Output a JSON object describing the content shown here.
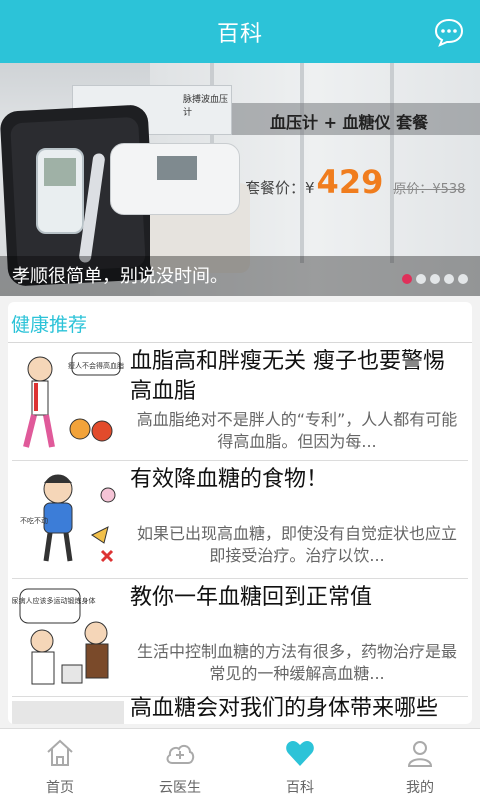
{
  "header": {
    "title": "百科"
  },
  "banner": {
    "tag": "血压计 + 血糖仪  套餐",
    "price_label": "套餐价：¥",
    "price_value": "429",
    "orig_price": "原价：¥538",
    "box_text": "脉搏波血压计",
    "caption": "孝顺很简单，别说没时间。",
    "dots_total": 5,
    "dots_active": 1
  },
  "section": {
    "title": "健康推荐"
  },
  "articles": [
    {
      "title": "血脂高和胖瘦无关 瘦子也要警惕高血脂",
      "desc": "高血脂绝对不是胖人的“专利”，人人都有可能得高血脂。但因为每...",
      "thumb_label": "瘦人不会得高血脂"
    },
    {
      "title": "有效降血糖的食物！",
      "desc": "如果已出现高血糖，即使没有自觉症状也应立即接受治疗。治疗以饮...",
      "thumb_label": "不吃不动"
    },
    {
      "title": "教你一年血糖回到正常值",
      "desc": "生活中控制血糖的方法有很多，药物治疗是最常见的一种缓解高血糖...",
      "thumb_label": "糖尿病人应该多运动锻炼身体"
    },
    {
      "title": "高血糖会对我们的身体带来哪些",
      "desc": "",
      "thumb_label": ""
    }
  ],
  "tabbar": {
    "tabs": [
      {
        "label": "首页",
        "icon": "home-icon"
      },
      {
        "label": "云医生",
        "icon": "cloud-doctor-icon"
      },
      {
        "label": "百科",
        "icon": "heart-icon"
      },
      {
        "label": "我的",
        "icon": "user-icon"
      }
    ],
    "active_index": 2
  },
  "colors": {
    "accent": "#2cc3d8",
    "price": "#f07d1e",
    "dot_active": "#e0305a"
  }
}
